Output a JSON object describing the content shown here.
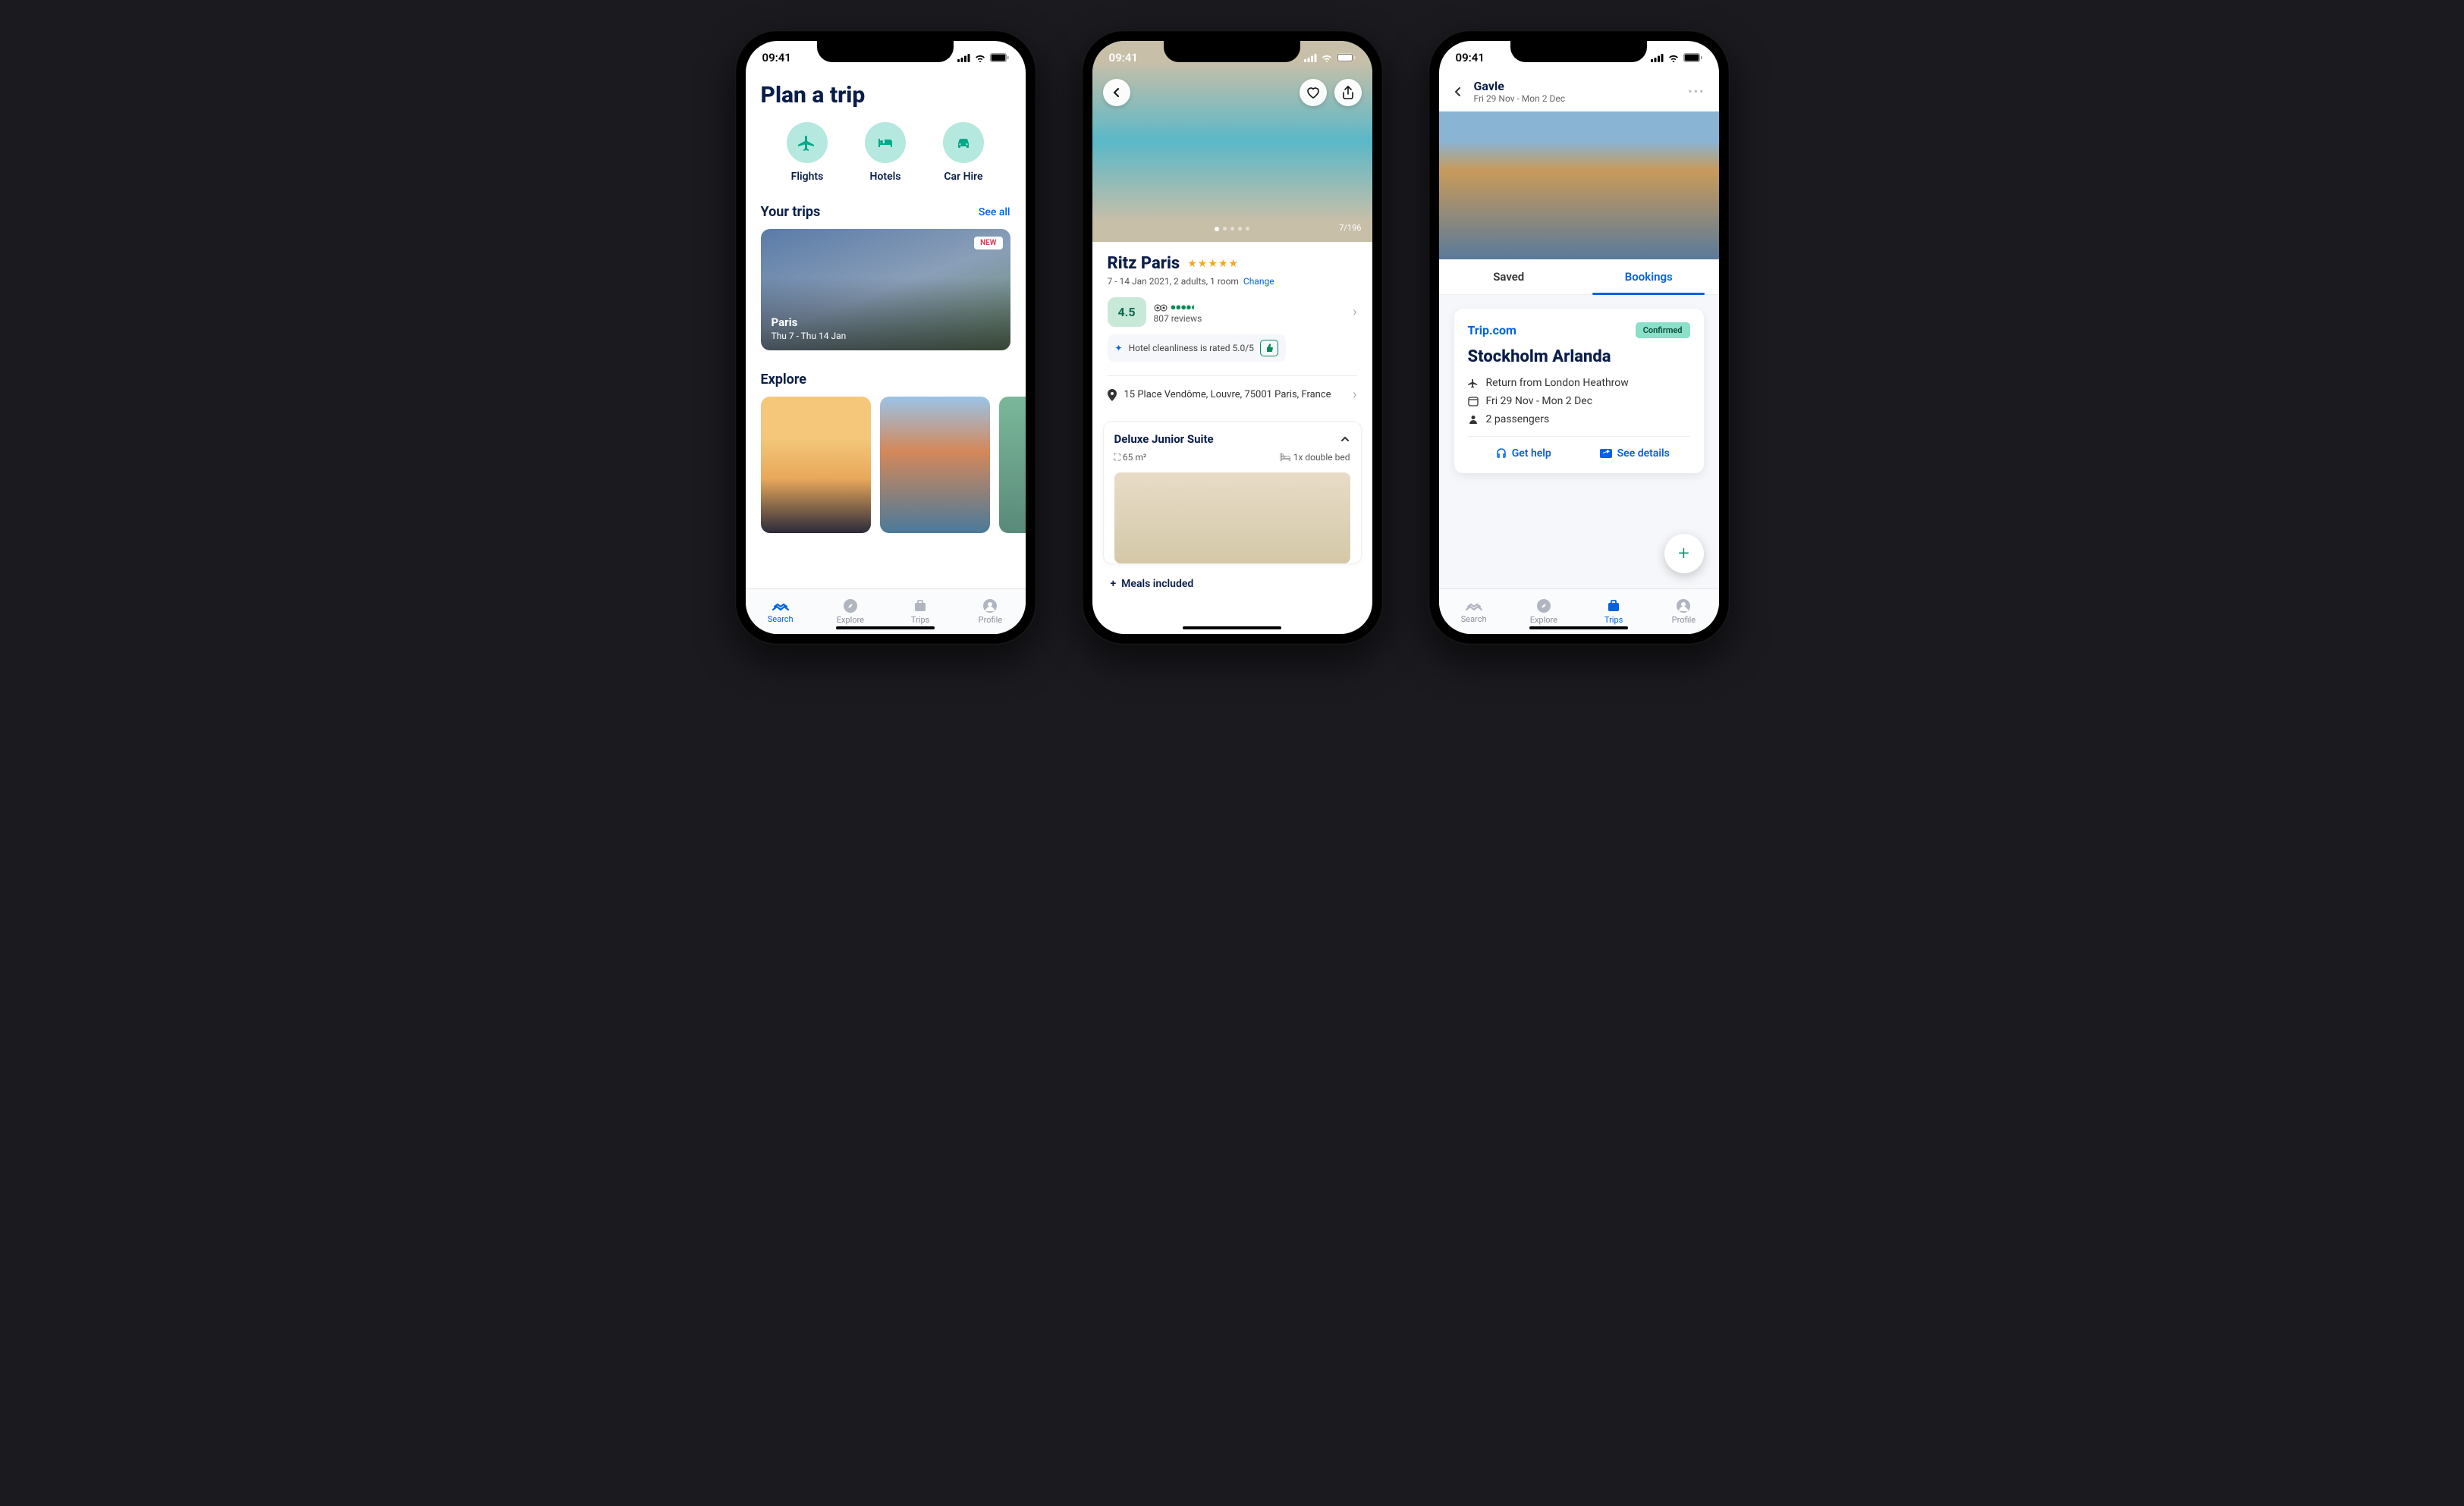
{
  "status": {
    "time": "09:41"
  },
  "phone1": {
    "title": "Plan a trip",
    "categories": [
      {
        "label": "Flights",
        "icon": "plane-icon"
      },
      {
        "label": "Hotels",
        "icon": "bed-icon"
      },
      {
        "label": "Car Hire",
        "icon": "car-icon"
      }
    ],
    "trips_section": "Your trips",
    "see_all": "See all",
    "trip": {
      "badge": "NEW",
      "city": "Paris",
      "dates": "Thu 7 - Thu 14 Jan"
    },
    "explore_section": "Explore",
    "tabs": [
      "Search",
      "Explore",
      "Trips",
      "Profile"
    ],
    "active_tab": 0
  },
  "phone2": {
    "photo_counter": "7/196",
    "hotel_name": "Ritz Paris",
    "stars": 5,
    "subtitle": "7 - 14 Jan 2021, 2 adults, 1 room",
    "change": "Change",
    "score": "4.5",
    "reviews": "807 reviews",
    "cleanliness": "Hotel cleanliness is rated 5.0/5",
    "address": "15 Place Vendôme, Louvre, 75001 Paris, France",
    "room": {
      "name": "Deluxe Junior Suite",
      "size": "65 m²",
      "bed": "1x double bed"
    },
    "meals": "Meals included"
  },
  "phone3": {
    "header": {
      "title": "Gavle",
      "dates": "Fri 29 Nov - Mon 2 Dec"
    },
    "segments": [
      "Saved",
      "Bookings"
    ],
    "active_segment": 1,
    "booking": {
      "provider": "Trip.com",
      "status": "Confirmed",
      "title": "Stockholm Arlanda",
      "return": "Return from London Heathrow",
      "dates": "Fri 29 Nov - Mon 2 Dec",
      "pax": "2 passengers",
      "help": "Get help",
      "details": "See details"
    },
    "tabs": [
      "Search",
      "Explore",
      "Trips",
      "Profile"
    ],
    "active_tab": 2
  }
}
